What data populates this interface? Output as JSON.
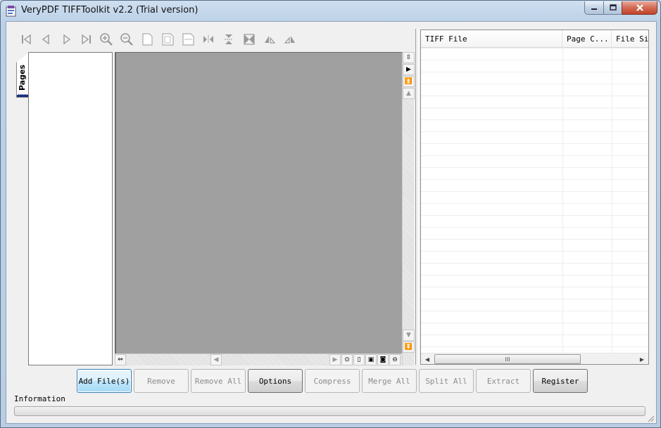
{
  "window": {
    "title": "VeryPDF TIFFToolkit v2.2 (Trial version)"
  },
  "toolbar": {
    "items": [
      {
        "name": "first-page-icon"
      },
      {
        "name": "previous-page-icon"
      },
      {
        "name": "next-page-icon"
      },
      {
        "name": "last-page-icon"
      },
      {
        "name": "zoom-in-icon"
      },
      {
        "name": "zoom-out-icon"
      },
      {
        "name": "actual-size-icon"
      },
      {
        "name": "fit-page-icon"
      },
      {
        "name": "fit-width-icon"
      },
      {
        "name": "flip-horizontal-icon"
      },
      {
        "name": "flip-vertical-icon"
      },
      {
        "name": "rotate-icon"
      },
      {
        "name": "rotate-left-icon"
      },
      {
        "name": "rotate-right-icon"
      }
    ]
  },
  "left_panel": {
    "tab_label": "Pages"
  },
  "file_list": {
    "columns": [
      "TIFF File",
      "Page C...",
      "File Siz"
    ]
  },
  "buttons": {
    "add_files": "Add File(s)",
    "remove": "Remove",
    "remove_all": "Remove All",
    "options": "Options",
    "compress": "Compress",
    "merge_all": "Merge All",
    "split_all": "Split All",
    "extract": "Extract",
    "register": "Register"
  },
  "status": {
    "info_label": "Information"
  },
  "colors": {
    "view_background": "#a0a0a0",
    "default_button_border": "#3c7fb1"
  }
}
